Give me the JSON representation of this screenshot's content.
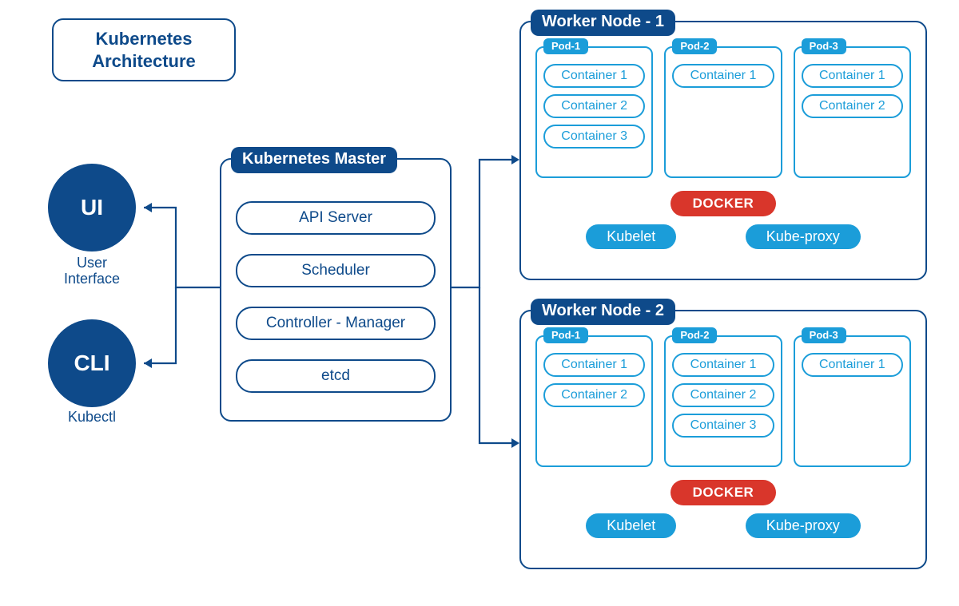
{
  "title": "Kubernetes\nArchitecture",
  "clients": {
    "ui": {
      "short": "UI",
      "label": "User\nInterface"
    },
    "cli": {
      "short": "CLI",
      "label": "Kubectl"
    }
  },
  "master": {
    "title": "Kubernetes Master",
    "components": [
      "API Server",
      "Scheduler",
      "Controller - Manager",
      "etcd"
    ]
  },
  "workers": [
    {
      "title": "Worker Node - 1",
      "pods": [
        {
          "name": "Pod-1",
          "containers": [
            "Container 1",
            "Container 2",
            "Container 3"
          ]
        },
        {
          "name": "Pod-2",
          "containers": [
            "Container 1"
          ]
        },
        {
          "name": "Pod-3",
          "containers": [
            "Container 1",
            "Container 2"
          ]
        }
      ],
      "runtime": "DOCKER",
      "services": [
        "Kubelet",
        "Kube-proxy"
      ]
    },
    {
      "title": "Worker Node - 2",
      "pods": [
        {
          "name": "Pod-1",
          "containers": [
            "Container 1",
            "Container 2"
          ]
        },
        {
          "name": "Pod-2",
          "containers": [
            "Container 1",
            "Container 2",
            "Container 3"
          ]
        },
        {
          "name": "Pod-3",
          "containers": [
            "Container 1"
          ]
        }
      ],
      "runtime": "DOCKER",
      "services": [
        "Kubelet",
        "Kube-proxy"
      ]
    }
  ]
}
